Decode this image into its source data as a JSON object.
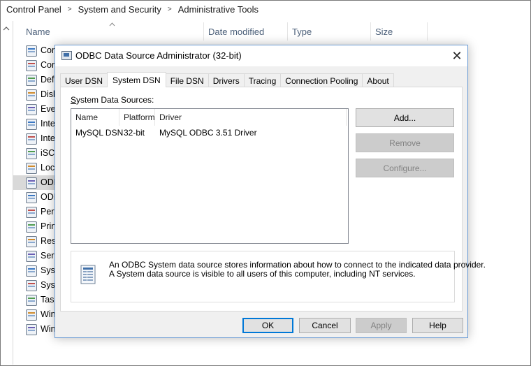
{
  "breadcrumb": {
    "items": [
      "Control Panel",
      "System and Security",
      "Administrative Tools"
    ],
    "separator": ">"
  },
  "columns": {
    "name": "Name",
    "date_modified": "Date modified",
    "type": "Type",
    "size": "Size"
  },
  "file_list": [
    {
      "label": "Cor",
      "icon": "component-services-icon"
    },
    {
      "label": "Cor",
      "icon": "computer-management-icon"
    },
    {
      "label": "Def",
      "icon": "defragment-icon"
    },
    {
      "label": "Disk",
      "icon": "disk-cleanup-icon"
    },
    {
      "label": "Eve",
      "icon": "event-viewer-icon"
    },
    {
      "label": "Inte",
      "icon": "iscsi-icon"
    },
    {
      "label": "Inte",
      "icon": "internet-information-icon"
    },
    {
      "label": "iSCS",
      "icon": "iscsi-initiator-icon"
    },
    {
      "label": "Loc",
      "icon": "local-security-policy-icon"
    },
    {
      "label": "ODE",
      "icon": "odbc-icon",
      "selected": true
    },
    {
      "label": "ODE",
      "icon": "odbc-icon"
    },
    {
      "label": "Perf",
      "icon": "performance-monitor-icon"
    },
    {
      "label": "Prin",
      "icon": "print-management-icon"
    },
    {
      "label": "Res",
      "icon": "resource-monitor-icon"
    },
    {
      "label": "Serv",
      "icon": "services-icon"
    },
    {
      "label": "Syst",
      "icon": "system-configuration-icon"
    },
    {
      "label": "Syst",
      "icon": "system-information-icon"
    },
    {
      "label": "Task",
      "icon": "task-scheduler-icon"
    },
    {
      "label": "Win",
      "icon": "windows-firewall-icon"
    },
    {
      "label": "Win",
      "icon": "windows-memory-diagnostic-icon"
    }
  ],
  "dialog": {
    "title": "ODBC Data Source Administrator (32-bit)",
    "close_glyph": "✕",
    "tabs": [
      {
        "label": "User DSN",
        "active": false
      },
      {
        "label": "System DSN",
        "active": true
      },
      {
        "label": "File DSN",
        "active": false
      },
      {
        "label": "Drivers",
        "active": false
      },
      {
        "label": "Tracing",
        "active": false
      },
      {
        "label": "Connection Pooling",
        "active": false
      },
      {
        "label": "About",
        "active": false
      }
    ],
    "section_label_first": "S",
    "section_label_rest": "ystem Data Sources:",
    "list_headers": {
      "name": "Name",
      "platform": "Platform",
      "driver": "Driver"
    },
    "rows": [
      {
        "name": "MySQL DSN",
        "platform": "32-bit",
        "driver": "MySQL ODBC 3.51 Driver"
      }
    ],
    "side_buttons": {
      "add_label": "Add...",
      "remove_label": "Remove",
      "configure_label": "Configure..."
    },
    "info_line1": "An ODBC System data source stores information about how to connect to the indicated data provider.",
    "info_line2": "A System data source is visible to all users of this computer, including NT services.",
    "bottom_buttons": {
      "ok_label": "OK",
      "cancel_label": "Cancel",
      "apply_label": "Apply",
      "help_label": "Help"
    }
  },
  "colors": {
    "header_text": "#4c607a",
    "dialog_border": "#6f9ed6",
    "default_button_border": "#0078d7",
    "disabled_text": "#838383"
  }
}
